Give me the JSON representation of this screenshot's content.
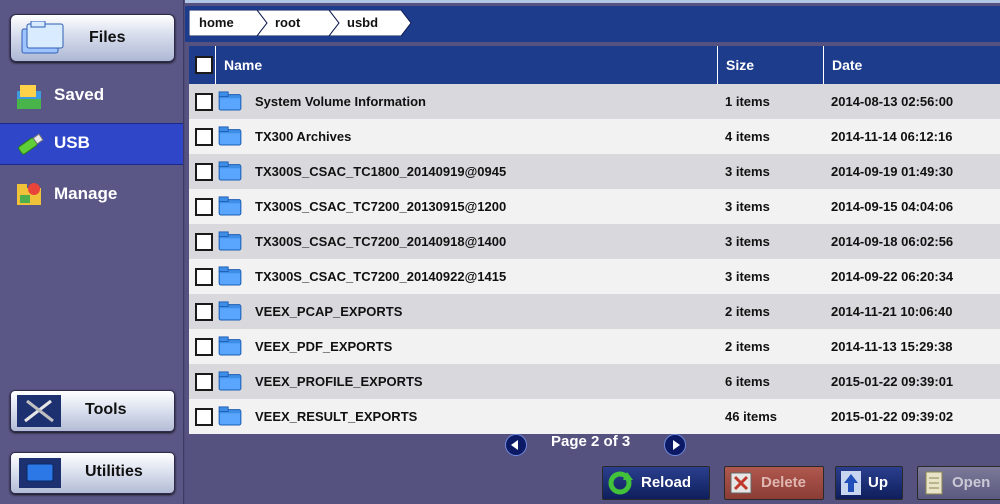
{
  "sidebar": {
    "files": {
      "label": "Files",
      "icon": "folders-icon"
    },
    "items": [
      {
        "label": "Saved",
        "icon": "saved-icon"
      },
      {
        "label": "USB",
        "icon": "usb-icon",
        "active": true
      },
      {
        "label": "Manage",
        "icon": "manage-icon"
      }
    ],
    "tools": {
      "label": "Tools",
      "icon": "tools-icon"
    },
    "utilities": {
      "label": "Utilities",
      "icon": "monitor-icon"
    }
  },
  "breadcrumb": [
    "home",
    "root",
    "usbd"
  ],
  "table": {
    "columns": {
      "name": "Name",
      "size": "Size",
      "date": "Date"
    },
    "rows": [
      {
        "name": "System Volume Information",
        "size": "1 items",
        "date": "2014-08-13 02:56:00"
      },
      {
        "name": "TX300 Archives",
        "size": "4 items",
        "date": "2014-11-14 06:12:16"
      },
      {
        "name": "TX300S_CSAC_TC1800_20140919@0945",
        "size": "3 items",
        "date": "2014-09-19 01:49:30"
      },
      {
        "name": "TX300S_CSAC_TC7200_20130915@1200",
        "size": "3 items",
        "date": "2014-09-15 04:04:06"
      },
      {
        "name": "TX300S_CSAC_TC7200_20140918@1400",
        "size": "3 items",
        "date": "2014-09-18 06:02:56"
      },
      {
        "name": "TX300S_CSAC_TC7200_20140922@1415",
        "size": "3 items",
        "date": "2014-09-22 06:20:34"
      },
      {
        "name": "VEEX_PCAP_EXPORTS",
        "size": "2 items",
        "date": "2014-11-21 10:06:40"
      },
      {
        "name": "VEEX_PDF_EXPORTS",
        "size": "2 items",
        "date": "2014-11-13 15:29:38"
      },
      {
        "name": "VEEX_PROFILE_EXPORTS",
        "size": "6 items",
        "date": "2015-01-22 09:39:01"
      },
      {
        "name": "VEEX_RESULT_EXPORTS",
        "size": "46 items",
        "date": "2015-01-22 09:39:02"
      }
    ]
  },
  "pager": {
    "label": "Page 2 of 3",
    "prev_icon": "prev-page-icon",
    "next_icon": "next-page-icon"
  },
  "actions": {
    "reload": "Reload",
    "delete": "Delete",
    "up": "Up",
    "open": "Open"
  },
  "colors": {
    "header_blue": "#1e3c8c",
    "row_alt": "#d9d9dd",
    "row": "#f2f2f2",
    "accent_active": "#2f46c8"
  }
}
